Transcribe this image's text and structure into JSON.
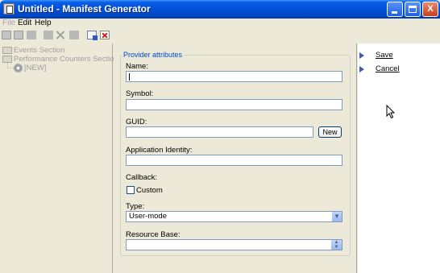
{
  "window": {
    "title": "Untitled - Manifest Generator",
    "controls": {
      "minimize_icon": "minimize-icon",
      "maximize_icon": "maximize-icon",
      "close_label": "X"
    }
  },
  "menu": {
    "items": [
      {
        "label": "File",
        "enabled": false
      },
      {
        "label": "Edit",
        "enabled": true
      },
      {
        "label": "Help",
        "enabled": true
      }
    ]
  },
  "toolbar": {
    "icons": [
      "new-icon",
      "open-icon",
      "save-icon",
      "cut-icon",
      "delete-icon",
      "undo-icon",
      "import-icon",
      "remove-icon"
    ]
  },
  "tree": {
    "items": [
      {
        "label": "Events Section"
      },
      {
        "label": "Performance Counters Section"
      },
      {
        "label": "[NEW]"
      }
    ]
  },
  "form": {
    "legend": "Provider attributes",
    "fields": {
      "name": {
        "label": "Name:",
        "value": ""
      },
      "symbol": {
        "label": "Symbol:",
        "value": ""
      },
      "guid": {
        "label": "GUID:",
        "value": "",
        "button_label": "New"
      },
      "app_identity": {
        "label": "Application Identity:",
        "value": ""
      },
      "callback": {
        "label": "Callback:",
        "checkbox_label": "Custom",
        "checked": false
      },
      "type": {
        "label": "Type:",
        "selected": "User-mode"
      },
      "resource_base": {
        "label": "Resource Base:",
        "value": ""
      }
    }
  },
  "actions": {
    "save_label": "Save",
    "cancel_label": "Cancel"
  },
  "colors": {
    "titlebar": "#0052d9",
    "legend_text": "#0046d5",
    "window_bg": "#ece9d8",
    "disabled_text": "#a0a0a0"
  }
}
